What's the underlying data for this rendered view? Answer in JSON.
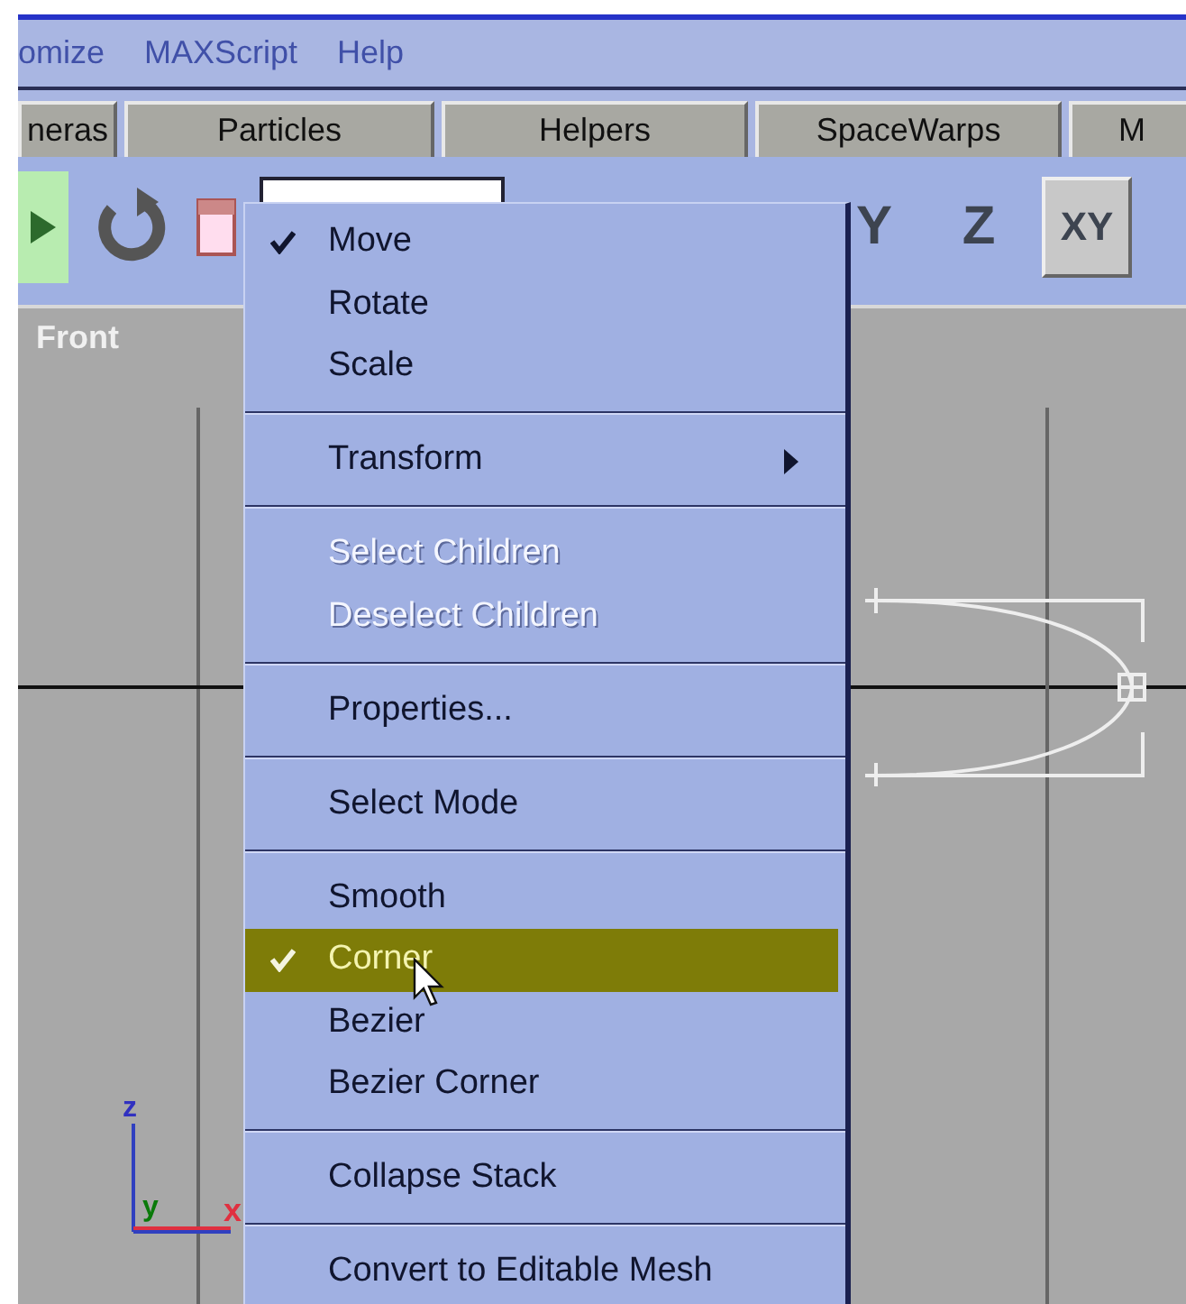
{
  "menu_bar": [
    "omize",
    "MAXScript",
    "Help"
  ],
  "tabs": [
    {
      "label": "neras"
    },
    {
      "label": "Particles"
    },
    {
      "label": "Helpers"
    },
    {
      "label": "SpaceWarps"
    },
    {
      "label": "M"
    }
  ],
  "toolbar": {
    "axis_buttons": [
      {
        "label": "Y",
        "selected": false
      },
      {
        "label": "Z",
        "selected": false
      },
      {
        "label": "XY",
        "selected": true
      }
    ]
  },
  "viewport": {
    "label": "Front",
    "axis_labels": [
      "z",
      "y",
      "x"
    ]
  },
  "context_menu": [
    {
      "kind": "item",
      "label": "Move",
      "checked": true,
      "disabled": false,
      "selected": false
    },
    {
      "kind": "item",
      "label": "Rotate",
      "checked": false,
      "disabled": false,
      "selected": false
    },
    {
      "kind": "item",
      "label": "Scale",
      "checked": false,
      "disabled": false,
      "selected": false
    },
    {
      "kind": "separator"
    },
    {
      "kind": "item",
      "label": "Transform",
      "checked": false,
      "disabled": false,
      "selected": false,
      "submenu": true
    },
    {
      "kind": "separator"
    },
    {
      "kind": "item",
      "label": "Select Children",
      "checked": false,
      "disabled": true,
      "selected": false
    },
    {
      "kind": "item",
      "label": "Deselect Children",
      "checked": false,
      "disabled": true,
      "selected": false
    },
    {
      "kind": "separator"
    },
    {
      "kind": "item",
      "label": "Properties...",
      "checked": false,
      "disabled": false,
      "selected": false
    },
    {
      "kind": "separator"
    },
    {
      "kind": "item",
      "label": "Select Mode",
      "checked": false,
      "disabled": false,
      "selected": false
    },
    {
      "kind": "separator"
    },
    {
      "kind": "item",
      "label": "Smooth",
      "checked": false,
      "disabled": false,
      "selected": false
    },
    {
      "kind": "item",
      "label": "Corner",
      "checked": true,
      "disabled": false,
      "selected": true
    },
    {
      "kind": "item",
      "label": "Bezier",
      "checked": false,
      "disabled": false,
      "selected": false
    },
    {
      "kind": "item",
      "label": "Bezier Corner",
      "checked": false,
      "disabled": false,
      "selected": false
    },
    {
      "kind": "separator"
    },
    {
      "kind": "item",
      "label": "Collapse Stack",
      "checked": false,
      "disabled": false,
      "selected": false
    },
    {
      "kind": "separator"
    },
    {
      "kind": "item",
      "label": "Convert to Editable Mesh",
      "checked": false,
      "disabled": false,
      "selected": false
    }
  ]
}
